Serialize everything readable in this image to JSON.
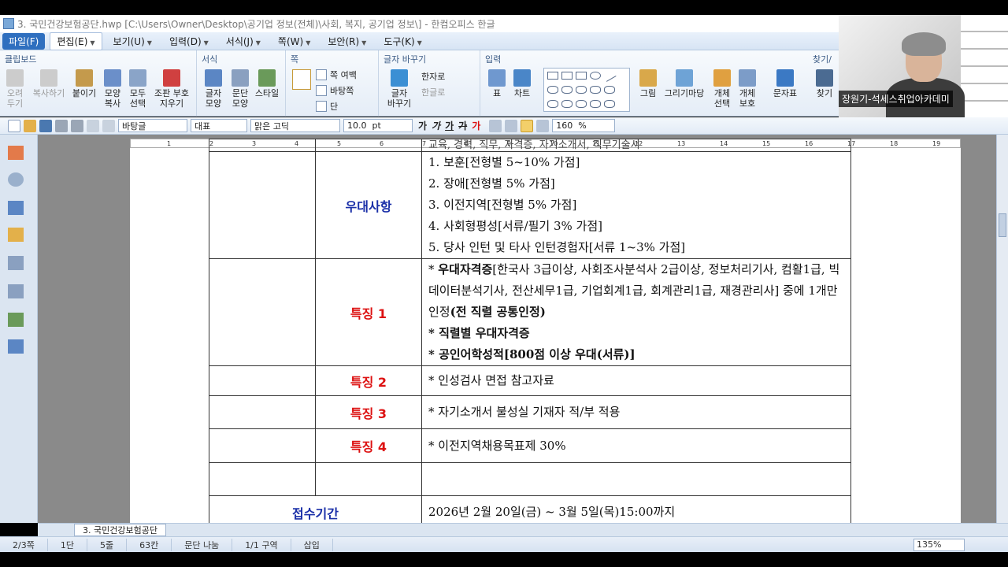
{
  "window": {
    "title": "3. 국민건강보험공단.hwp [C:\\Users\\Owner\\Desktop\\공기업 정보(전체)\\사회, 복지, 공기업 정보\\] - 한컴오피스 한글"
  },
  "menu": [
    {
      "label": "파일(F)"
    },
    {
      "label": "편집(E)"
    },
    {
      "label": "보기(U)"
    },
    {
      "label": "입력(D)"
    },
    {
      "label": "서식(J)"
    },
    {
      "label": "쪽(W)"
    },
    {
      "label": "보안(R)"
    },
    {
      "label": "도구(K)"
    }
  ],
  "ribbon": {
    "groups": {
      "clipboard": "클립보드",
      "format": "서식",
      "page": "쪽",
      "replace": "글자 바꾸기",
      "insert": "입력",
      "find": "찾기/"
    },
    "buttons": {
      "cut": "오려\n두기",
      "copy": "복사하기",
      "paste": "붙이기",
      "shape_copy": "모양\n복사",
      "select_all": "모두\n선택",
      "erase_code": "조판 부호\n지우기",
      "char_shape": "글자\n모양",
      "para_shape": "문단\n모양",
      "style": "스타일",
      "page_margin": "쪽 여백",
      "background": "바탕쪽",
      "column": "단",
      "hanja": "한자로",
      "hangul": "한글로",
      "char_replace": "글자\n바꾸기",
      "table": "표",
      "chart": "차트",
      "picture": "그림",
      "drawing": "그리기마당",
      "obj_select": "개체\n선택",
      "obj_protect": "개체\n보호",
      "char_table": "문자표",
      "find": "찾기"
    }
  },
  "format_toolbar": {
    "style": "바탕글",
    "lang": "대표",
    "font": "맑은 고딕",
    "size": "10.0",
    "unit": "pt",
    "bold": "가",
    "italic": "가",
    "underline": "가",
    "strike": "가",
    "color": "가",
    "line_spacing": "160",
    "percent": "%"
  },
  "ruler": [
    "1",
    "2",
    "3",
    "4",
    "5",
    "6",
    "7",
    "8",
    "9",
    "10",
    "11",
    "12",
    "13",
    "14",
    "15",
    "16",
    "17",
    "18",
    "19"
  ],
  "document": {
    "cut_top_line": "교육, 경력, 직무, 자격증, 자기소개서, 직무기술서",
    "sections": [
      {
        "label": "우대사항",
        "lines": [
          "1. 보훈[전형별 5~10% 가점]",
          "2. 장애[전형별 5% 가점]",
          "3. 이전지역[전형별 5% 가점]",
          "4. 사회형평성[서류/필기 3% 가점]",
          "5. 당사 인턴 및 타사 인턴경험자[서류 1~3% 가점]"
        ]
      },
      {
        "label": "특징 1",
        "p1_bullet": "* ",
        "p1_bold": "우대자격증",
        "p1_rest": "[한국사 3급이상, 사회조사분석사 2급이상, 정보처리기사, 컴활1급, 빅데이터분석기사, 전산세무1급, 기업회계1급, 회계관리1급, 재경관리사] 중에 1개만 인정",
        "p1_end": "(전 직렬 공통인정)",
        "p2": "* 직렬별 우대자격증",
        "p3": "* 공인어학성적[800점 이상 우대(서류)]"
      },
      {
        "label": "특징 2",
        "text": "* 인성검사 면접 참고자료"
      },
      {
        "label": "특징 3",
        "text": "* 자기소개서 불성실 기재자 적/부 적용"
      },
      {
        "label": "특징 4",
        "text": "* 이전지역채용목표제 30%"
      }
    ],
    "period_label": "접수기간",
    "period_value": "2026년 2월 20일(금) ~ 3월 5일(목)15:00까지"
  },
  "tab": {
    "label": "3. 국민건강보험공단"
  },
  "status": {
    "page": "2/3쪽",
    "column": "1단",
    "line": "5줄",
    "char": "63칸",
    "mode1": "문단 나눔",
    "section": "1/1 구역",
    "insert": "삽입",
    "zoom": "135%"
  },
  "webcam": {
    "name": "장원기-석세스취업아카데미"
  },
  "colors": {
    "accent": "#2f6fbf",
    "red_label": "#d11111",
    "blue_label": "#1a2fa8"
  }
}
